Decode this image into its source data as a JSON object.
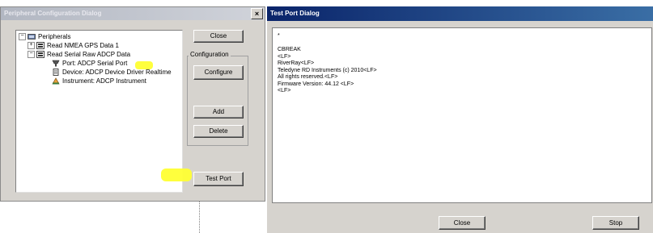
{
  "left_dialog": {
    "title": "Peripheral Configuration Dialog",
    "close_glyph": "×",
    "tree": [
      {
        "label": "Peripherals",
        "expander": "−",
        "icon": "peripherals-icon",
        "level": 0
      },
      {
        "label": "Read NMEA GPS Data 1",
        "expander": "+",
        "icon": "data-reader-icon",
        "level": 1
      },
      {
        "label": "Read Serial Raw ADCP Data",
        "expander": "−",
        "icon": "data-reader-icon",
        "level": 1
      },
      {
        "label": "Port: ADCP Serial Port",
        "expander": "",
        "icon": "serial-port-icon",
        "level": 2,
        "highlighted": true
      },
      {
        "label": "Device: ADCP Device Driver Realtime",
        "expander": "",
        "icon": "device-icon",
        "level": 2
      },
      {
        "label": "Instrument: ADCP Instrument",
        "expander": "",
        "icon": "instrument-icon",
        "level": 2
      }
    ],
    "buttons": {
      "close": "Close",
      "configure": "Configure",
      "add": "Add",
      "delete": "Delete",
      "test_port": "Test Port"
    },
    "group_label": "Configuration"
  },
  "right_dialog": {
    "title": "Test Port Dialog",
    "close_glyph": "×",
    "output_lines": [
      "*",
      "",
      "CBREAK",
      "<LF>",
      "RiverRay<LF>",
      "Teledyne RD Instruments (c) 2010<LF>",
      "All rights reserved.<LF>",
      "Firmware Version: 44.12 <LF>",
      "<LF>"
    ],
    "buttons": {
      "close": "Close",
      "stop": "Stop"
    }
  },
  "colors": {
    "highlight": "#ffff33",
    "active_title": "#0a246a",
    "inactive_title": "#b2b7c2"
  }
}
